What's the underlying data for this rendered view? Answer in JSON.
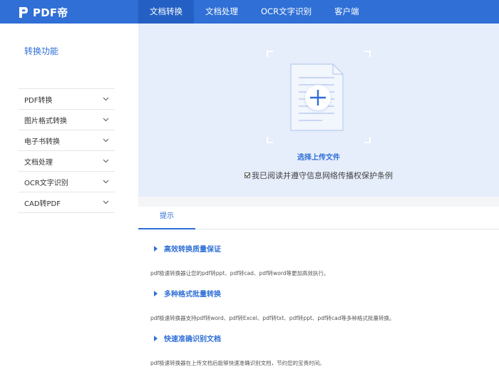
{
  "header": {
    "logo_text": "PDF帝",
    "nav": [
      {
        "label": "文档转换",
        "active": true
      },
      {
        "label": "文档处理",
        "active": false
      },
      {
        "label": "OCR文字识别",
        "active": false
      },
      {
        "label": "客户端",
        "active": false
      }
    ]
  },
  "sidebar": {
    "title": "转换功能",
    "items": [
      {
        "label": "PDF转换"
      },
      {
        "label": "图片格式转换"
      },
      {
        "label": "电子书转换"
      },
      {
        "label": "文档处理"
      },
      {
        "label": "OCR文字识别"
      },
      {
        "label": "CAD转PDF"
      }
    ]
  },
  "upload": {
    "choose_label": "选择上传文件",
    "agree_text": "我已阅读并遵守信息网络传播权保护条例",
    "agree_checked": true
  },
  "tips": {
    "tab_label": "提示",
    "items": [
      {
        "title": "高效转换质量保证",
        "desc": "pdf极速转换器让您的pdf转ppt、pdf转cad、pdf转word等更加高效执行。"
      },
      {
        "title": "多种格式批量转换",
        "desc": "pdf极速转换器支持pdf转word、pdf转Excel、pdf转txt、pdf转ppt、pdf转cad等多种格式批量转换。"
      },
      {
        "title": "快速准确识别文档",
        "desc": "pdf极速转换器在上传文档后能够快速准确识别文档，节约您的宝贵时间。"
      }
    ]
  },
  "colors": {
    "brand": "#2f6fd6",
    "upload_bg": "#e6eefb"
  }
}
